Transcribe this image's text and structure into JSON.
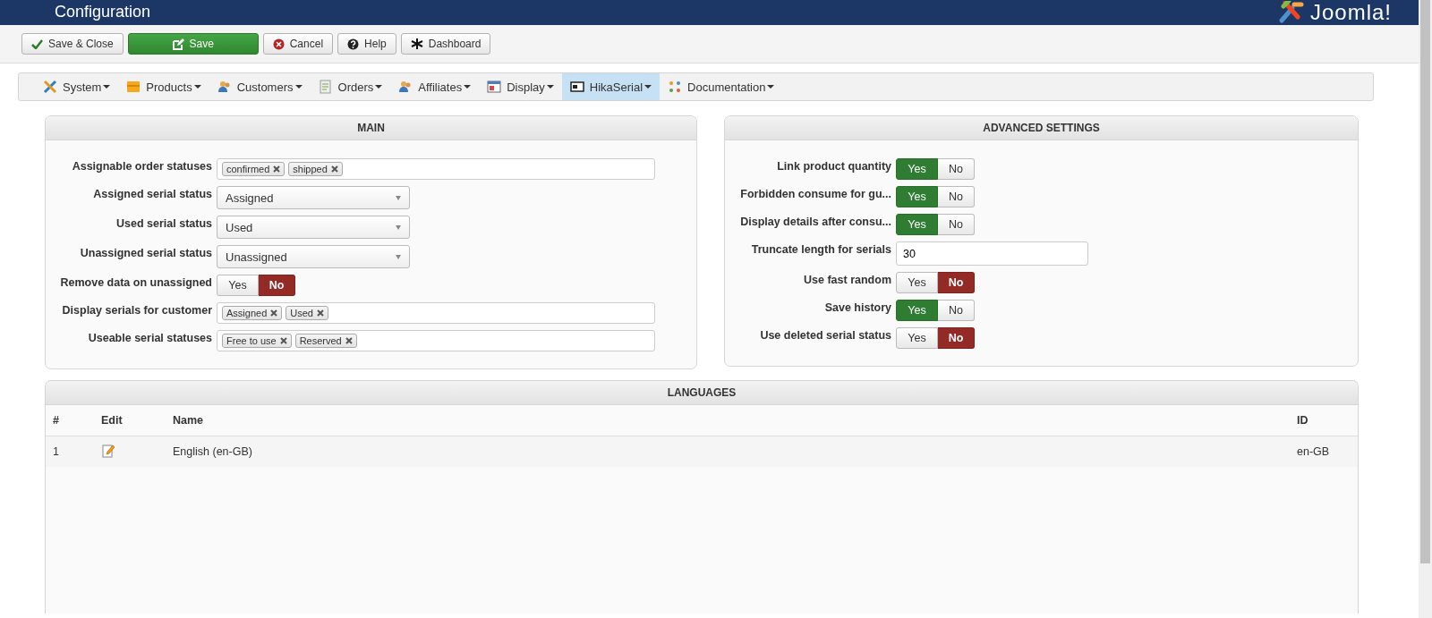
{
  "header": {
    "title": "Configuration",
    "logo": "Joomla!"
  },
  "toolbar": [
    {
      "label": "Save & Close",
      "kind": "check"
    },
    {
      "label": "Save",
      "kind": "save"
    },
    {
      "label": "Cancel",
      "kind": "cancel"
    },
    {
      "label": "Help",
      "kind": "help"
    },
    {
      "label": "Dashboard",
      "kind": "dashboard"
    }
  ],
  "menu": [
    {
      "label": "System",
      "kind": "tools",
      "selected": false
    },
    {
      "label": "Products",
      "kind": "box",
      "selected": false
    },
    {
      "label": "Customers",
      "kind": "people",
      "selected": false
    },
    {
      "label": "Orders",
      "kind": "doc",
      "selected": false
    },
    {
      "label": "Affiliates",
      "kind": "people",
      "selected": false
    },
    {
      "label": "Display",
      "kind": "window",
      "selected": false
    },
    {
      "label": "HikaSerial",
      "kind": "serial",
      "selected": true
    },
    {
      "label": "Documentation",
      "kind": "dots",
      "selected": false
    }
  ],
  "main": {
    "title": "MAIN",
    "rows": [
      {
        "label": "Assignable order statuses",
        "kind": "tags",
        "tags": [
          "confirmed",
          "shipped"
        ]
      },
      {
        "label": "Assigned serial status",
        "kind": "select",
        "value": "Assigned"
      },
      {
        "label": "Used serial status",
        "kind": "select",
        "value": "Used"
      },
      {
        "label": "Unassigned serial status",
        "kind": "select",
        "value": "Unassigned"
      },
      {
        "label": "Remove data on unassigned",
        "kind": "toggle",
        "yes": "Yes",
        "no": "No",
        "on": false
      },
      {
        "label": "Display serials for customer",
        "kind": "tags",
        "tags": [
          "Assigned",
          "Used"
        ]
      },
      {
        "label": "Useable serial statuses",
        "kind": "tags",
        "tags": [
          "Free to use",
          "Reserved"
        ]
      }
    ]
  },
  "advanced": {
    "title": "ADVANCED SETTINGS",
    "rows": [
      {
        "label": "Link product quantity",
        "kind": "toggle",
        "yes": "Yes",
        "no": "No",
        "on": true
      },
      {
        "label": "Forbidden consume for gu...",
        "kind": "toggle",
        "yes": "Yes",
        "no": "No",
        "on": true
      },
      {
        "label": "Display details after consu...",
        "kind": "toggle",
        "yes": "Yes",
        "no": "No",
        "on": true
      },
      {
        "label": "Truncate length for serials",
        "kind": "text",
        "value": "30"
      },
      {
        "label": "Use fast random",
        "kind": "toggle",
        "yes": "Yes",
        "no": "No",
        "on": false
      },
      {
        "label": "Save history",
        "kind": "toggle",
        "yes": "Yes",
        "no": "No",
        "on": true
      },
      {
        "label": "Use deleted serial status",
        "kind": "toggle",
        "yes": "Yes",
        "no": "No",
        "on": false
      }
    ]
  },
  "languages": {
    "title": "LANGUAGES",
    "columns": [
      "#",
      "Edit",
      "Name",
      "ID"
    ],
    "rows": [
      {
        "number": "1",
        "name": "English (en-GB)",
        "id": "en-GB"
      }
    ]
  }
}
